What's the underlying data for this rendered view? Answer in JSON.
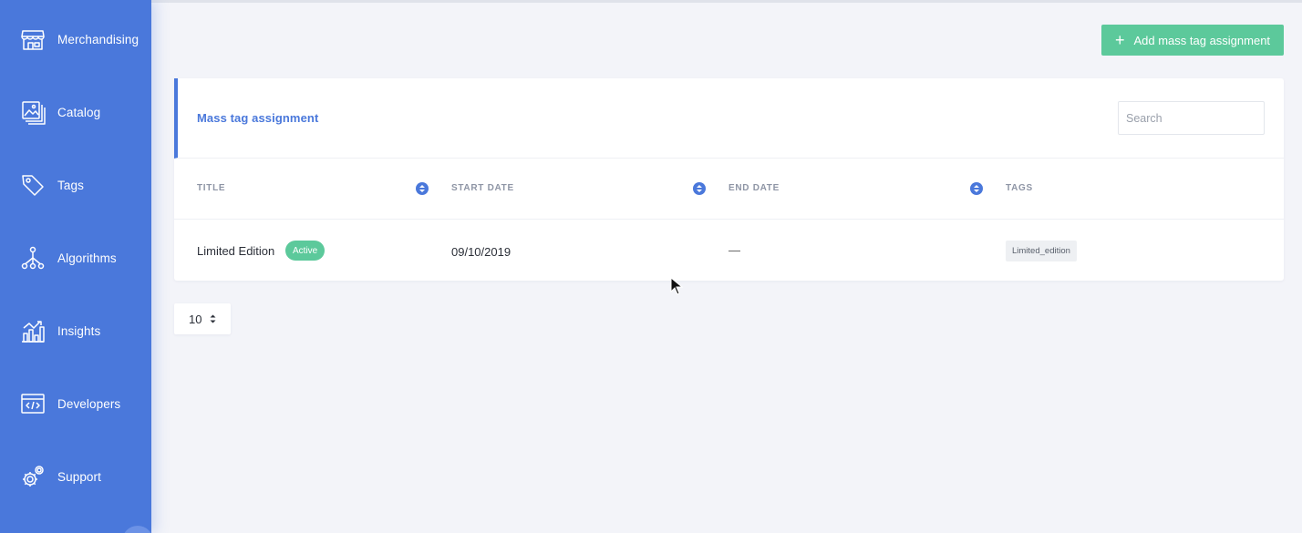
{
  "sidebar": {
    "items": [
      {
        "label": "Merchandising",
        "icon": "store-icon"
      },
      {
        "label": "Catalog",
        "icon": "catalog-icon"
      },
      {
        "label": "Tags",
        "icon": "tag-icon"
      },
      {
        "label": "Algorithms",
        "icon": "algorithm-icon"
      },
      {
        "label": "Insights",
        "icon": "insights-chart-icon"
      },
      {
        "label": "Developers",
        "icon": "code-window-icon"
      },
      {
        "label": "Support",
        "icon": "gear-icon"
      }
    ]
  },
  "header": {
    "add_button_label": "Add mass tag assignment",
    "add_button_icon": "plus-icon"
  },
  "card": {
    "title": "Mass tag assignment",
    "search_placeholder": "Search",
    "columns": [
      "TITLE",
      "START DATE",
      "END DATE",
      "TAGS"
    ],
    "rows": [
      {
        "title": "Limited Edition",
        "status": "Active",
        "start_date": "09/10/2019",
        "end_date": "—",
        "tags": [
          "Limited_edition"
        ]
      }
    ]
  },
  "pager": {
    "page_size": "10"
  },
  "colors": {
    "sidebar": "#4a78db",
    "accent_green": "#5cc99b",
    "background": "#f3f4f9",
    "primary_text": "#2b2f38"
  }
}
